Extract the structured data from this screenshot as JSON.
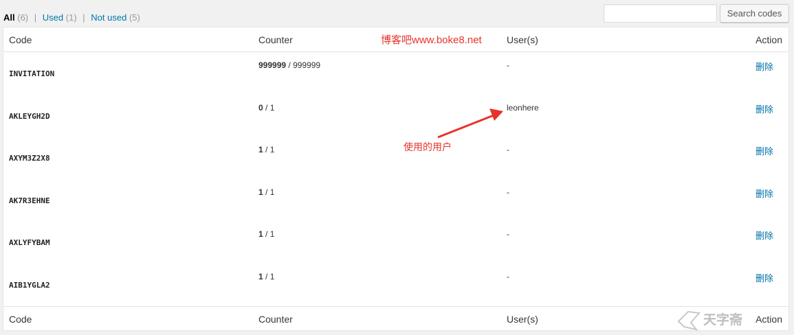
{
  "filters": {
    "all_label": "All",
    "all_count": "(6)",
    "used_label": "Used",
    "used_count": "(1)",
    "not_used_label": "Not used",
    "not_used_count": "(5)",
    "separator": "|"
  },
  "search": {
    "value": "",
    "placeholder": "",
    "button_label": "Search codes"
  },
  "columns": {
    "code": "Code",
    "counter": "Counter",
    "users": "User(s)",
    "action": "Action"
  },
  "rows": [
    {
      "code": "INVITATION",
      "used": "999999",
      "sep": " / ",
      "total": "999999",
      "user": "-",
      "action": "删除"
    },
    {
      "code": "AKLEYGH2D",
      "used": "0",
      "sep": " / ",
      "total": "1",
      "user": "leonhere",
      "action": "删除"
    },
    {
      "code": "AXYM3Z2X8",
      "used": "1",
      "sep": " / ",
      "total": "1",
      "user": "-",
      "action": "删除"
    },
    {
      "code": "AK7R3EHNE",
      "used": "1",
      "sep": " / ",
      "total": "1",
      "user": "-",
      "action": "删除"
    },
    {
      "code": "AXLYFYBAM",
      "used": "1",
      "sep": " / ",
      "total": "1",
      "user": "-",
      "action": "删除"
    },
    {
      "code": "AIB1YGLA2",
      "used": "1",
      "sep": " / ",
      "total": "1",
      "user": "-",
      "action": "删除"
    }
  ],
  "overlay": {
    "watermark_text": "博客吧www.boke8.net",
    "annotation": "使用的用户",
    "logo_text": "天字斋"
  },
  "colors": {
    "link": "#0073aa",
    "annotation_red": "#e8322a",
    "background": "#f1f1f1"
  }
}
